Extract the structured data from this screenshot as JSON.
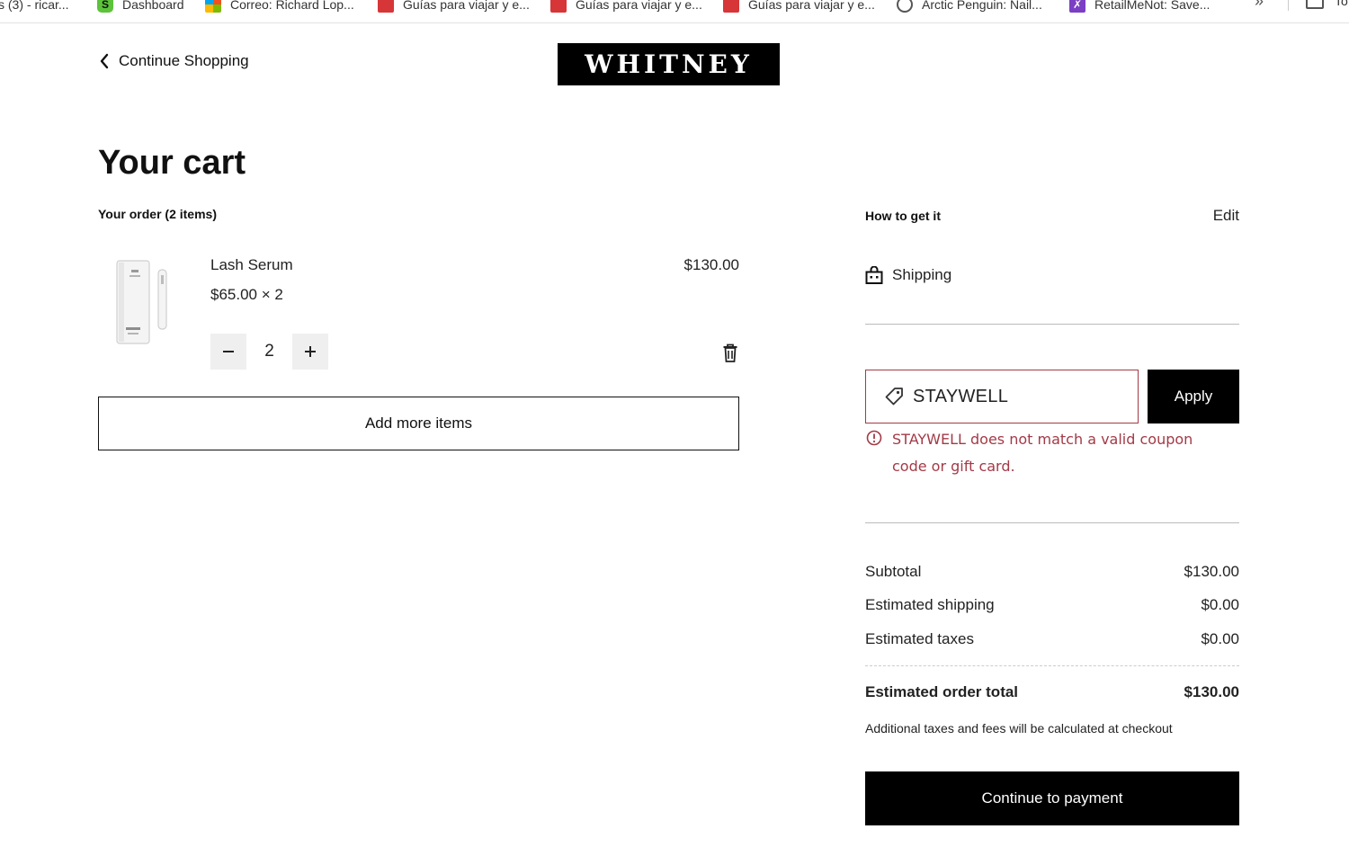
{
  "bookmarks": [
    {
      "label": "s (3) - ricar...",
      "icon": "none"
    },
    {
      "label": "Dashboard",
      "icon": "s-icon"
    },
    {
      "label": "Correo: Richard Lop...",
      "icon": "microsoft-icon"
    },
    {
      "label": "Guías para viajar y e...",
      "icon": "guide-icon"
    },
    {
      "label": "Guías para viajar y e...",
      "icon": "guide-icon"
    },
    {
      "label": "Guías para viajar y e...",
      "icon": "guide-icon"
    },
    {
      "label": "Arctic Penguin: Nail...",
      "icon": "penguin-icon"
    },
    {
      "label": "RetailMeNot: Save...",
      "icon": "retailmenot-icon"
    }
  ],
  "bookmarks_more": "»",
  "bookmarks_last": "To",
  "header": {
    "continue_label": "Continue Shopping",
    "logo_text": "WHITNEY"
  },
  "cart": {
    "title": "Your cart",
    "order_count": "Your order (2 items)",
    "items": [
      {
        "name": "Lash Serum",
        "unit_price": "$65.00 × 2",
        "line_total": "$130.00",
        "quantity": "2"
      }
    ],
    "add_more_label": "Add more items"
  },
  "fulfillment": {
    "title": "How to get it",
    "edit_label": "Edit",
    "method": "Shipping"
  },
  "coupon": {
    "value": "STAYWELL",
    "apply_label": "Apply",
    "error": "STAYWELL does not match a valid coupon code or gift card."
  },
  "summary": {
    "subtotal_label": "Subtotal",
    "subtotal": "$130.00",
    "shipping_label": "Estimated shipping",
    "shipping": "$0.00",
    "taxes_label": "Estimated taxes",
    "taxes": "$0.00",
    "total_label": "Estimated order total",
    "total": "$130.00",
    "note": "Additional taxes and fees will be calculated at checkout",
    "pay_label": "Continue to payment"
  },
  "colors": {
    "error": "#a33a46",
    "primary_button": "#000000"
  }
}
